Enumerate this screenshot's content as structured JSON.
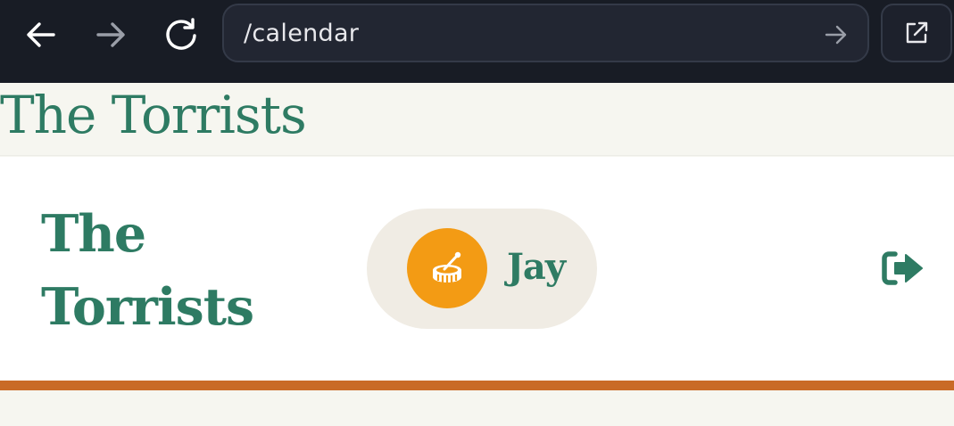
{
  "browser": {
    "back_icon": "arrow-left-icon",
    "forward_icon": "arrow-right-icon",
    "reload_icon": "reload-icon",
    "url": "/calendar",
    "go_icon": "arrow-right-icon",
    "open_external_icon": "external-link-icon"
  },
  "site": {
    "title": "The Torrists"
  },
  "header": {
    "brand_line1": "The",
    "brand_line2": "Torrists",
    "user": {
      "name": "Jay",
      "avatar_icon": "drum-icon",
      "avatar_color": "#f39b14"
    },
    "logout_icon": "sign-out-icon"
  },
  "colors": {
    "brand_green": "#2e7b63",
    "accent_rule": "#c96a26",
    "pill_bg": "#f0ece4",
    "browser_bg": "#181c25"
  }
}
